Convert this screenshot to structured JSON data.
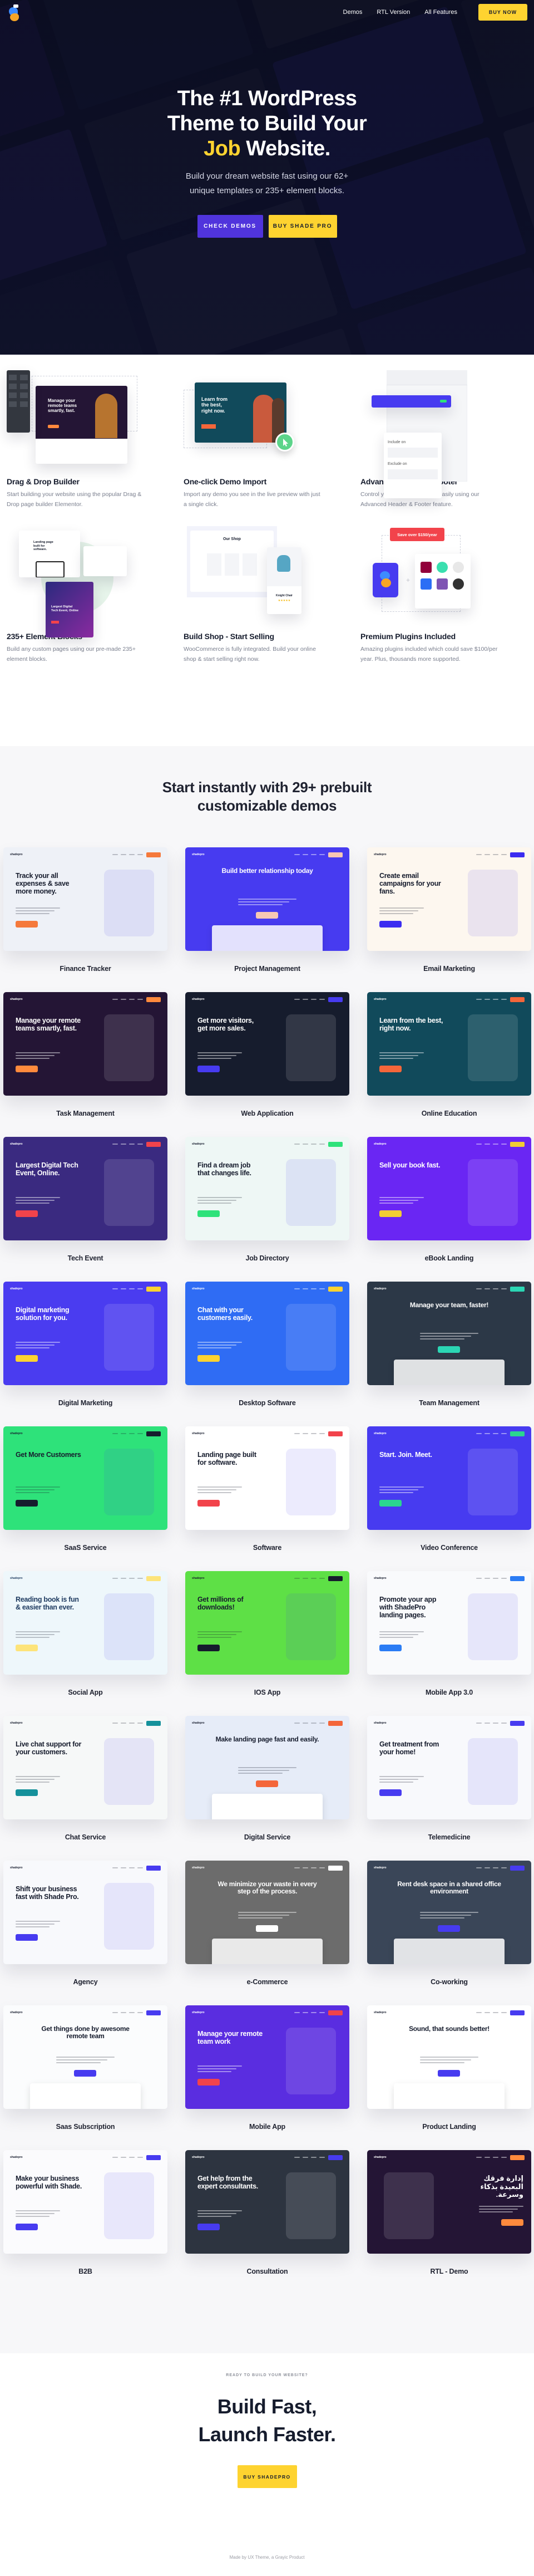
{
  "nav": {
    "logo": "shadepro-logo",
    "links": [
      "Demos",
      "RTL Version",
      "All Features"
    ],
    "buy_label": "BUY NOW"
  },
  "hero": {
    "title_line1": "The #1 WordPress",
    "title_line2": "Theme to Build Your",
    "title_highlight": "Job",
    "title_rest": " Website.",
    "subtitle_line1": "Build your dream website fast using our 62+",
    "subtitle_line2": "unique templates or 235+ element blocks.",
    "primary_button": "CHECK DEMOS",
    "secondary_button": "BUY SHADE PRO"
  },
  "features": [
    {
      "title": "Drag & Drop Builder",
      "description": "Start building your website using the popular Drag & Drop page builder Elementor.",
      "mock_text": "Manage your remote teams smartly, fast."
    },
    {
      "title": "One-click Demo Import",
      "description": "Import any demo you see in the live preview with just a single click.",
      "mock_text": "Learn from the best, right now."
    },
    {
      "title": "Advanced Header & Footer",
      "description": "Control your headers & footer easily using our Advanced Header & Footer feature.",
      "mock_include": "Include on",
      "mock_exclude": "Exclude on"
    },
    {
      "title": "235+ Element Blocks",
      "description": "Build any custom pages using our pre-made 235+ element blocks.",
      "mock_text": "Landing page built for software.",
      "mock_text2": "Largest Digital Tech Event, Online"
    },
    {
      "title": "Build Shop - Start Selling",
      "description": "WooCommerce is fully integrated. Build your online shop & start selling right now.",
      "mock_text": "Our Shop",
      "mock_product": "Knight Chair"
    },
    {
      "title": "Premium Plugins Included",
      "description": "Amazing plugins included which could save $100/per year. Plus, thousands more supported.",
      "mock_badge": "Save over $150/year"
    }
  ],
  "demos": {
    "title_line1": "Start instantly with 29+ prebuilt",
    "title_line2": "customizable demos",
    "items": [
      {
        "label": "Finance Tracker",
        "headline": "Track your all expenses & save more money.",
        "bg": "#eef1f7",
        "fg": "#161c2d",
        "accent": "#f5793b"
      },
      {
        "label": "Project Management",
        "headline": "Build better relationship today",
        "bg": "#473bf0",
        "fg": "#ffffff",
        "accent": "#f8c7b4"
      },
      {
        "label": "Email Marketing",
        "headline": "Create email campaigns for your fans.",
        "bg": "#fdf7ef",
        "fg": "#161c2d",
        "accent": "#3b2cf0"
      },
      {
        "label": "Task Management",
        "headline": "Manage your remote teams smartly, fast.",
        "bg": "#241535",
        "fg": "#ffffff",
        "accent": "#ff8a3d"
      },
      {
        "label": "Web Application",
        "headline": "Get more visitors, get more sales.",
        "bg": "#161c2d",
        "fg": "#ffffff",
        "accent": "#473bf0"
      },
      {
        "label": "Online Education",
        "headline": "Learn from the best, right now.",
        "bg": "#114a5b",
        "fg": "#ffffff",
        "accent": "#f4663a"
      },
      {
        "label": "Tech Event",
        "headline": "Largest Digital Tech Event, Online.",
        "bg": "#3a2a80",
        "fg": "#ffffff",
        "accent": "#f2434b"
      },
      {
        "label": "Job Directory",
        "headline": "Find a dream job that changes life.",
        "bg": "#eef7f5",
        "fg": "#161c2d",
        "accent": "#2ee27a"
      },
      {
        "label": "eBook Landing",
        "headline": "Sell your book fast.",
        "bg": "#6a26f3",
        "fg": "#ffffff",
        "accent": "#f2cd34"
      },
      {
        "label": "Digital Marketing",
        "headline": "Digital marketing solution for you.",
        "bg": "#4a3cf0",
        "fg": "#ffffff",
        "accent": "#fed330"
      },
      {
        "label": "Desktop Software",
        "headline": "Chat with your customers easily.",
        "bg": "#2f6cf4",
        "fg": "#ffffff",
        "accent": "#fed330"
      },
      {
        "label": "Team Management",
        "headline": "Manage your team, faster!",
        "bg": "#2c3847",
        "fg": "#ffffff",
        "accent": "#2bd6b4"
      },
      {
        "label": "SaaS Service",
        "headline": "Get More Customers",
        "bg": "#2ee27a",
        "fg": "#161c2d",
        "accent": "#161c2d"
      },
      {
        "label": "Software",
        "headline": "Landing page built for software.",
        "bg": "#ffffff",
        "fg": "#161c2d",
        "accent": "#f2434b"
      },
      {
        "label": "Video Conference",
        "headline": "Start. Join. Meet.",
        "bg": "#473bf0",
        "fg": "#ffffff",
        "accent": "#2bd68f"
      },
      {
        "label": "Social App",
        "headline": "Reading book is fun & easier than ever.",
        "bg": "#eef7fb",
        "fg": "#1e3a5f",
        "accent": "#fde47a"
      },
      {
        "label": "IOS App",
        "headline": "Get millions of downloads!",
        "bg": "#5ee046",
        "fg": "#161c2d",
        "accent": "#161c2d"
      },
      {
        "label": "Mobile App 3.0",
        "headline": "Promote your app with ShadePro landing pages.",
        "bg": "#f9fafc",
        "fg": "#161c2d",
        "accent": "#2b7cf4"
      },
      {
        "label": "Chat Service",
        "headline": "Live chat support for your customers.",
        "bg": "#f6f8f8",
        "fg": "#161c2d",
        "accent": "#15919b"
      },
      {
        "label": "Digital Service",
        "headline": "Make landing page fast and easily.",
        "bg": "#e6ecf8",
        "fg": "#161c2d",
        "accent": "#f4663a"
      },
      {
        "label": "Telemedicine",
        "headline": "Get treatment from your home!",
        "bg": "#f8f9fc",
        "fg": "#161c2d",
        "accent": "#473bf0"
      },
      {
        "label": "Agency",
        "headline": "Shift your business fast with Shade Pro.",
        "bg": "#f8f9fc",
        "fg": "#161c2d",
        "accent": "#473bf0"
      },
      {
        "label": "e-Commerce",
        "headline": "We minimize your waste in every step of the process.",
        "bg": "#6c6c6c",
        "fg": "#ffffff",
        "accent": "#ffffff"
      },
      {
        "label": "Co-working",
        "headline": "Rent desk space in a shared office environment",
        "bg": "#3a4658",
        "fg": "#ffffff",
        "accent": "#473bf0"
      },
      {
        "label": "Saas Subscription",
        "headline": "Get things done by awesome remote team",
        "bg": "#fbfcfd",
        "fg": "#161c2d",
        "accent": "#473bf0"
      },
      {
        "label": "Mobile App",
        "headline": "Manage your remote team work",
        "bg": "#5a2de0",
        "fg": "#ffffff",
        "accent": "#f2434b"
      },
      {
        "label": "Product Landing",
        "headline": "Sound, that sounds better!",
        "bg": "#ffffff",
        "fg": "#161c2d",
        "accent": "#473bf0"
      },
      {
        "label": "B2B",
        "headline": "Make your business powerful with Shade.",
        "bg": "#fbfbfd",
        "fg": "#161c2d",
        "accent": "#473bf0"
      },
      {
        "label": "Consultation",
        "headline": "Get help from the expert consultants.",
        "bg": "#2d3440",
        "fg": "#ffffff",
        "accent": "#473bf0"
      },
      {
        "label": "RTL - Demo",
        "headline": "إدارة فرقك البعيدة بذكاء وسرعة.",
        "bg": "#241535",
        "fg": "#ffffff",
        "accent": "#ff8a3d"
      }
    ]
  },
  "cta": {
    "eyebrow": "READY TO BUILD YOUR WEBSITE?",
    "title_line1": "Build Fast,",
    "title_line2": "Launch Faster.",
    "button": "BUY SHADEPRO",
    "footer": "Made by UX Theme, a Grayic Product"
  },
  "colors": {
    "brand_yellow": "#fed330",
    "brand_purple": "#5034dc",
    "hero_bg": "#0d1028",
    "demos_bg": "#f7f7f9",
    "text_dark": "#161c2d"
  }
}
